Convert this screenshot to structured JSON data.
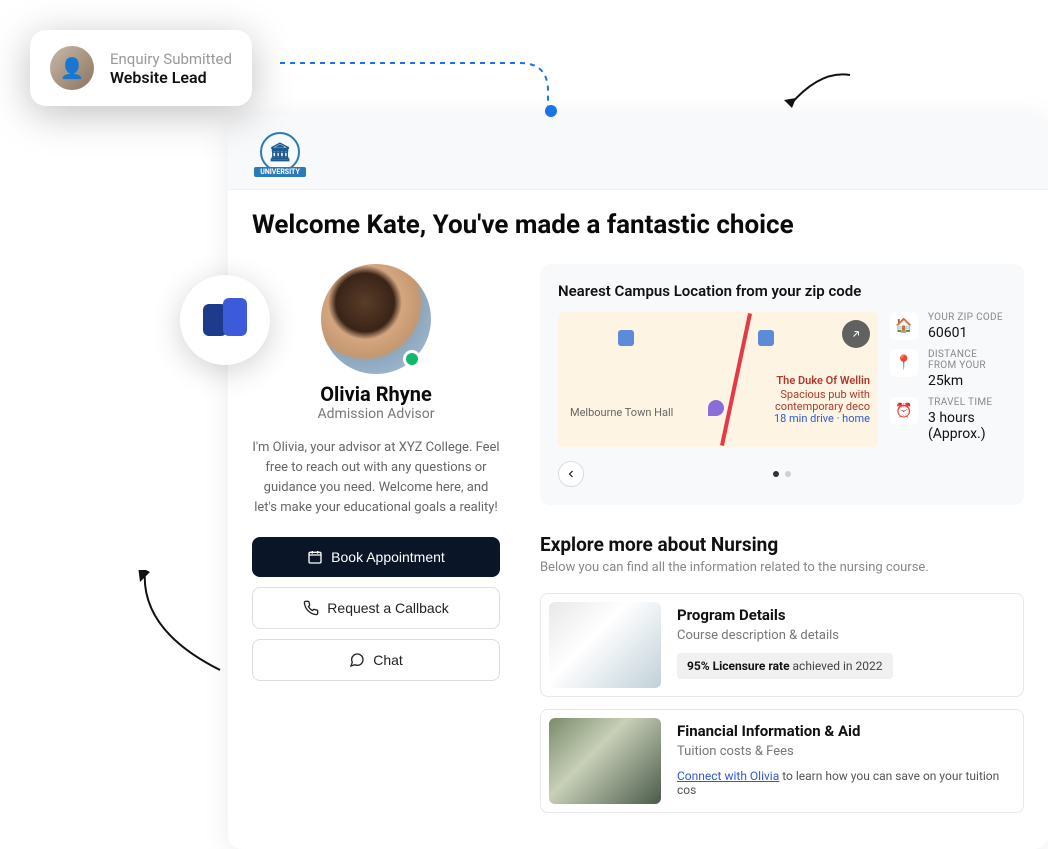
{
  "lead": {
    "title": "Enquiry Submitted",
    "source": "Website Lead"
  },
  "uni_name": "UNIVERSITY",
  "welcome": "Welcome Kate, You've made a fantastic choice",
  "advisor": {
    "name": "Olivia Rhyne",
    "role": "Admission Advisor",
    "message": "I'm Olivia, your advisor at XYZ College. Feel free to reach out with any questions or guidance you need. Welcome here, and let's make your educational goals a reality!",
    "buttons": {
      "book": "Book Appointment",
      "callback": "Request a Callback",
      "chat": "Chat"
    }
  },
  "campus": {
    "title": "Nearest Campus Location from your zip code",
    "map_labels": {
      "venue": "The Duke Of Wellin",
      "venue_sub1": "Spacious pub with",
      "venue_sub2": "contemporary deco",
      "venue_sub3": "18 min drive · home",
      "hall": "Melbourne Town Hall"
    },
    "stats": {
      "zip_label": "YOUR ZIP CODE",
      "zip_value": "60601",
      "dist_label": "DISTANCE FROM YOUR",
      "dist_value": "25km",
      "time_label": "TRAVEL TIME",
      "time_value": "3 hours (Approx.)"
    }
  },
  "explore": {
    "title": "Explore more about Nursing",
    "subtitle": "Below you can find all the information related to the nursing course.",
    "items": [
      {
        "title": "Program Details",
        "desc": "Course description & details",
        "badge_bold": "95% Licensure rate",
        "badge_rest": " achieved in 2022"
      },
      {
        "title": "Financial Information & Aid",
        "desc": "Tuition costs & Fees",
        "link_text": "Connect with Olivia",
        "link_rest": " to learn how you can save on your tuition cos"
      }
    ]
  }
}
